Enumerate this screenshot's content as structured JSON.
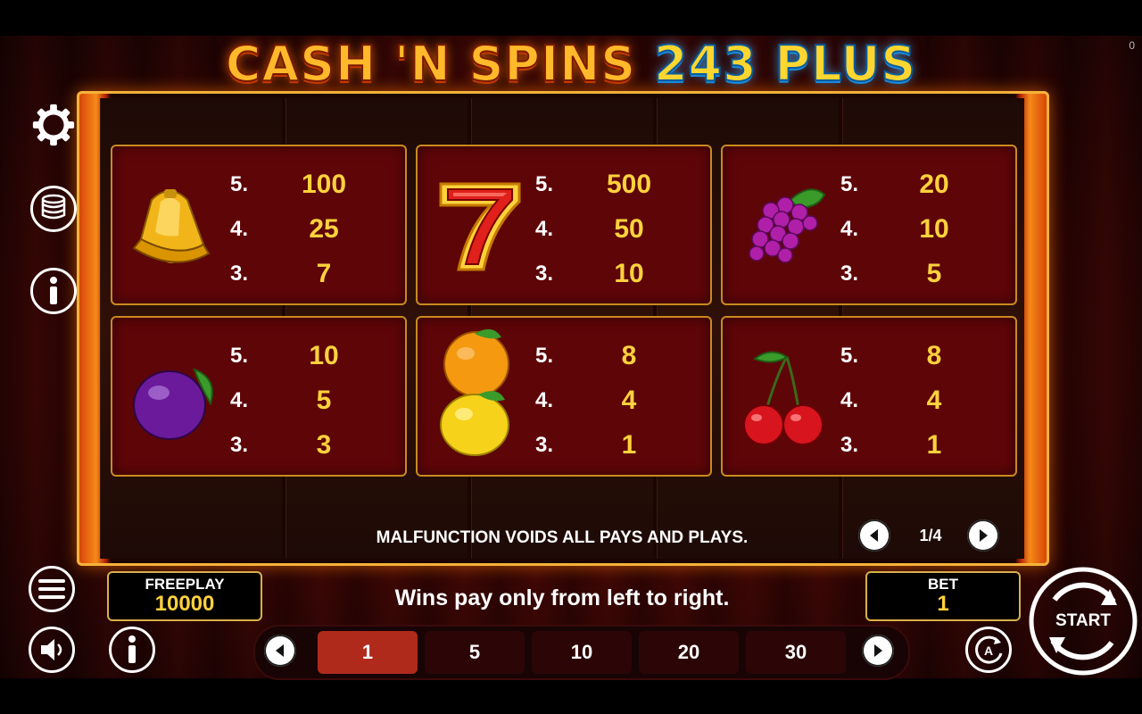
{
  "title": {
    "part1": "CASH 'N SPINS",
    "part2": "243 PLUS"
  },
  "counter": "0",
  "paytable": [
    {
      "symbol": "bell-icon",
      "rows": [
        {
          "n": "5.",
          "v": "100"
        },
        {
          "n": "4.",
          "v": "25"
        },
        {
          "n": "3.",
          "v": "7"
        }
      ]
    },
    {
      "symbol": "seven-icon",
      "rows": [
        {
          "n": "5.",
          "v": "500"
        },
        {
          "n": "4.",
          "v": "50"
        },
        {
          "n": "3.",
          "v": "10"
        }
      ]
    },
    {
      "symbol": "grapes-icon",
      "rows": [
        {
          "n": "5.",
          "v": "20"
        },
        {
          "n": "4.",
          "v": "10"
        },
        {
          "n": "3.",
          "v": "5"
        }
      ]
    },
    {
      "symbol": "plum-icon",
      "rows": [
        {
          "n": "5.",
          "v": "10"
        },
        {
          "n": "4.",
          "v": "5"
        },
        {
          "n": "3.",
          "v": "3"
        }
      ]
    },
    {
      "symbol": "orange-lemon-icon",
      "rows": [
        {
          "n": "5.",
          "v": "8"
        },
        {
          "n": "4.",
          "v": "4"
        },
        {
          "n": "3.",
          "v": "1"
        }
      ]
    },
    {
      "symbol": "cherry-icon",
      "rows": [
        {
          "n": "5.",
          "v": "8"
        },
        {
          "n": "4.",
          "v": "4"
        },
        {
          "n": "3.",
          "v": "1"
        }
      ]
    }
  ],
  "malfunction": "MALFUNCTION VOIDS ALL PAYS AND PLAYS.",
  "page_indicator": "1/4",
  "freeplay": {
    "label": "FREEPLAY",
    "value": "10000"
  },
  "bet": {
    "label": "BET",
    "value": "1"
  },
  "wins_text": "Wins pay only from left to right.",
  "bet_options": [
    "1",
    "5",
    "10",
    "20",
    "30"
  ],
  "selected_bet": "1",
  "start_label": "START",
  "colors": {
    "accent": "#ffd23c",
    "panel": "#5e0508",
    "border": "#c98a1f",
    "active_bet": "#b02a1c"
  }
}
